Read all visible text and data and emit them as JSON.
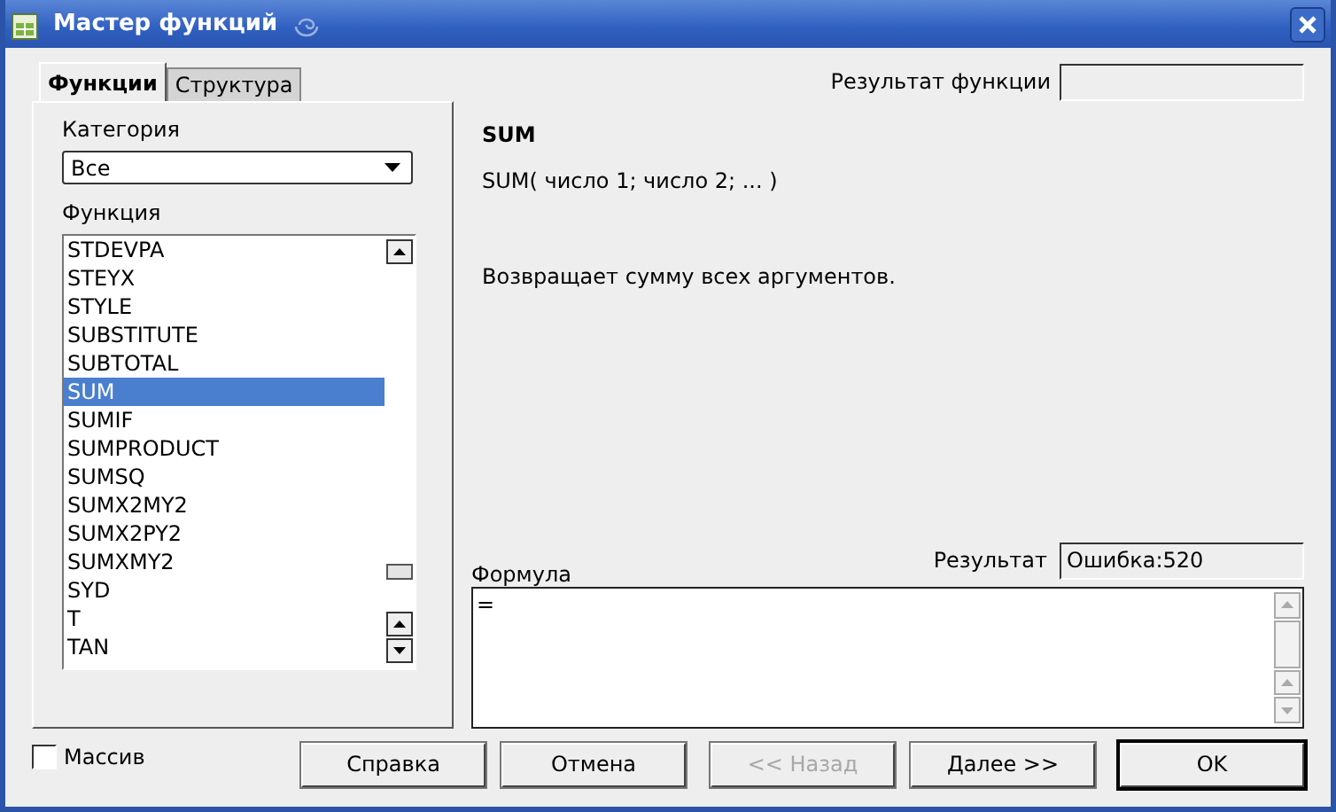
{
  "window": {
    "title": "Мастер функций"
  },
  "tabs": [
    {
      "label": "Функции",
      "selected": true
    },
    {
      "label": "Структура",
      "selected": false
    }
  ],
  "function_result": {
    "label": "Результат функции"
  },
  "category": {
    "label": "Категория",
    "value": "Все"
  },
  "function_list": {
    "label": "Функция",
    "items": [
      {
        "name": "STDEVPA",
        "selected": false
      },
      {
        "name": "STEYX",
        "selected": false
      },
      {
        "name": "STYLE",
        "selected": false
      },
      {
        "name": "SUBSTITUTE",
        "selected": false
      },
      {
        "name": "SUBTOTAL",
        "selected": false
      },
      {
        "name": "SUM",
        "selected": true
      },
      {
        "name": "SUMIF",
        "selected": false
      },
      {
        "name": "SUMPRODUCT",
        "selected": false
      },
      {
        "name": "SUMSQ",
        "selected": false
      },
      {
        "name": "SUMX2MY2",
        "selected": false
      },
      {
        "name": "SUMX2PY2",
        "selected": false
      },
      {
        "name": "SUMXMY2",
        "selected": false
      },
      {
        "name": "SYD",
        "selected": false
      },
      {
        "name": "T",
        "selected": false
      },
      {
        "name": "TAN",
        "selected": false
      }
    ]
  },
  "function_name": "SUM",
  "syntax": "SUM( число 1; число 2; ...  )",
  "description": "Возвращает сумму всех аргументов.",
  "formula": {
    "label": "Формула",
    "value": "="
  },
  "result": {
    "label": "Результат",
    "value": "Ошибка:520"
  },
  "array": {
    "label": "Массив",
    "checked": false
  },
  "buttons": [
    {
      "label": "Справка",
      "disabled": false,
      "default": false
    },
    {
      "label": "Отмена",
      "disabled": false,
      "default": false
    },
    {
      "label": "<< Назад",
      "disabled": true,
      "default": false
    },
    {
      "label": "Далее >>",
      "disabled": false,
      "default": false
    },
    {
      "label": "OK",
      "disabled": false,
      "default": true
    }
  ]
}
